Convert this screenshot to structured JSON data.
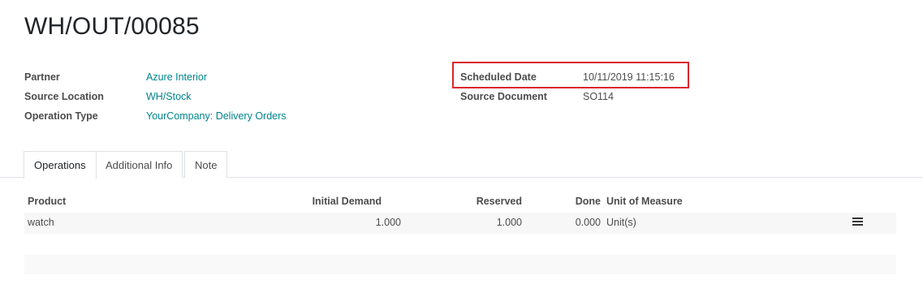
{
  "record": {
    "title": "WH/OUT/00085"
  },
  "fields_left": [
    {
      "label": "Partner",
      "value": "Azure Interior"
    },
    {
      "label": "Source Location",
      "value": "WH/Stock"
    },
    {
      "label": "Operation Type",
      "value": "YourCompany: Delivery Orders"
    }
  ],
  "fields_right": [
    {
      "label": "Scheduled Date",
      "value": "10/11/2019 11:15:16"
    },
    {
      "label": "Source Document",
      "value": "SO114"
    }
  ],
  "tabs": [
    {
      "label": "Operations",
      "active": true
    },
    {
      "label": "Additional Info",
      "active": false
    },
    {
      "label": "Note",
      "active": false
    }
  ],
  "table": {
    "headers": {
      "product": "Product",
      "initial_demand": "Initial Demand",
      "reserved": "Reserved",
      "done": "Done",
      "uom": "Unit of Measure"
    },
    "rows": [
      {
        "product": "watch",
        "initial_demand": "1.000",
        "reserved": "1.000",
        "done": "0.000",
        "uom": "Unit(s)",
        "icon": "list-icon"
      }
    ]
  },
  "colors": {
    "link": "#00838a",
    "highlight": "#d9262e"
  }
}
